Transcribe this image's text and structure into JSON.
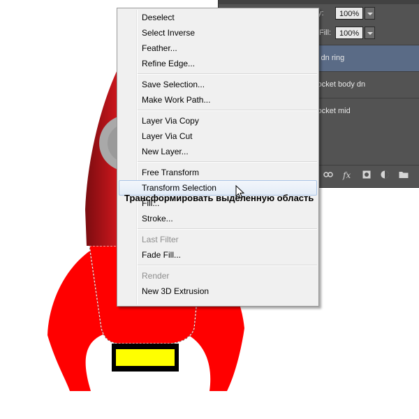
{
  "layers_panel": {
    "opacity": {
      "label": "city:",
      "value": "100%"
    },
    "fill": {
      "label": "Fill:",
      "value": "100%"
    },
    "layers": [
      {
        "name": "y dn ring",
        "selected": true
      },
      {
        "name": "rocket body dn",
        "selected": false
      },
      {
        "name": "rocket mid",
        "selected": false
      }
    ],
    "footer_icons": [
      "link-icon",
      "fx-icon",
      "mask-icon",
      "adjustment-icon",
      "folder-icon"
    ],
    "fx_label": "fx"
  },
  "context_menu": {
    "groups": [
      [
        "Deselect",
        "Select Inverse",
        "Feather...",
        "Refine Edge..."
      ],
      [
        "Save Selection...",
        "Make Work Path..."
      ],
      [
        "Layer Via Copy",
        "Layer Via Cut",
        "New Layer..."
      ],
      [
        "Free Transform",
        "Transform Selection",
        "Fill...",
        "Stroke..."
      ],
      [
        "Last Filter",
        "Fade Fill..."
      ],
      [
        "Render",
        "New 3D Extrusion"
      ]
    ],
    "highlighted": "Transform Selection",
    "disabled": [
      "Last Filter",
      "Render"
    ]
  },
  "tooltip": "Трансформировать выделенную область",
  "colors": {
    "rocket_red": "#ff0000",
    "rocket_dark_red": "#b8141a",
    "porthole_gray": "#a9a9a9",
    "nozzle_yellow": "#ffff00",
    "panel_bg": "#535353",
    "selected_layer": "#5a6b86"
  }
}
